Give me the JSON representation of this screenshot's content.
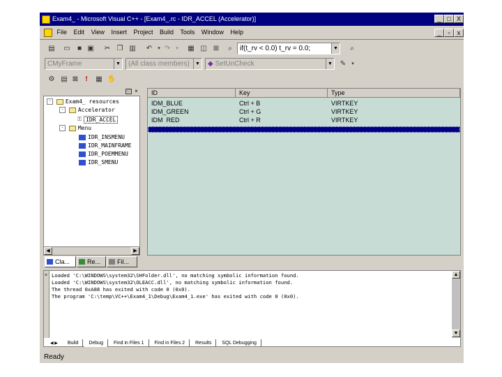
{
  "window": {
    "title": "Exam4_ - Microsoft Visual C++ - [Exam4_.rc - IDR_ACCEL (Accelerator)]",
    "controls": [
      "_",
      "□",
      "X"
    ],
    "mdi_controls": [
      "_",
      "▫",
      "x"
    ]
  },
  "menu": [
    "File",
    "Edit",
    "View",
    "Insert",
    "Project",
    "Build",
    "Tools",
    "Window",
    "Help"
  ],
  "toolbar": {
    "find_combo": "if(t_rv < 0.0) t_rv = 0.0;",
    "class_combo": "CMyFrame",
    "members_combo": "(All class members)",
    "function_combo": "SetUnCheck"
  },
  "tree": {
    "root": "Exam4_ resources",
    "accelerator_folder": "Accelerator",
    "accelerator_item": "IDR_ACCEL",
    "menu_folder": "Menu",
    "menu_items": [
      "IDR_INSMENU",
      "IDR_MAINFRAME",
      "IDR_POEMMENU",
      "IDR_SMENU"
    ]
  },
  "left_tabs": [
    "Cla...",
    "Re...",
    "Fil..."
  ],
  "accel_table": {
    "columns": [
      "ID",
      "Key",
      "Type"
    ],
    "rows": [
      {
        "id": "IDM_BLUE",
        "key": "Ctrl + B",
        "type": "VIRTKEY"
      },
      {
        "id": "IDM_GREEN",
        "key": "Ctrl + G",
        "type": "VIRTKEY"
      },
      {
        "id": "IDM_RED",
        "key": "Ctrl + R",
        "type": "VIRTKEY"
      }
    ]
  },
  "output": {
    "lines": [
      "Loaded 'C:\\WINDOWS\\system32\\SHFolder.dll', no matching symbolic information found.",
      "Loaded 'C:\\WINDOWS\\system32\\OLEACC.dll', no matching symbolic information found.",
      "The thread 0xA88 has exited with code 0 (0x0).",
      "The program 'C:\\temp\\VC++\\Exam4_1\\Debug\\Exam4_1.exe' has exited with code 0 (0x0)."
    ],
    "tabs": [
      "Build",
      "Debug",
      "Find in Files 1",
      "Find in Files 2",
      "Results",
      "SQL Debugging"
    ]
  },
  "status": "Ready",
  "colors": {
    "title": "#000080",
    "face": "#d4d0c8",
    "selection": "#000080",
    "table_bg": "#c8dcd6"
  }
}
